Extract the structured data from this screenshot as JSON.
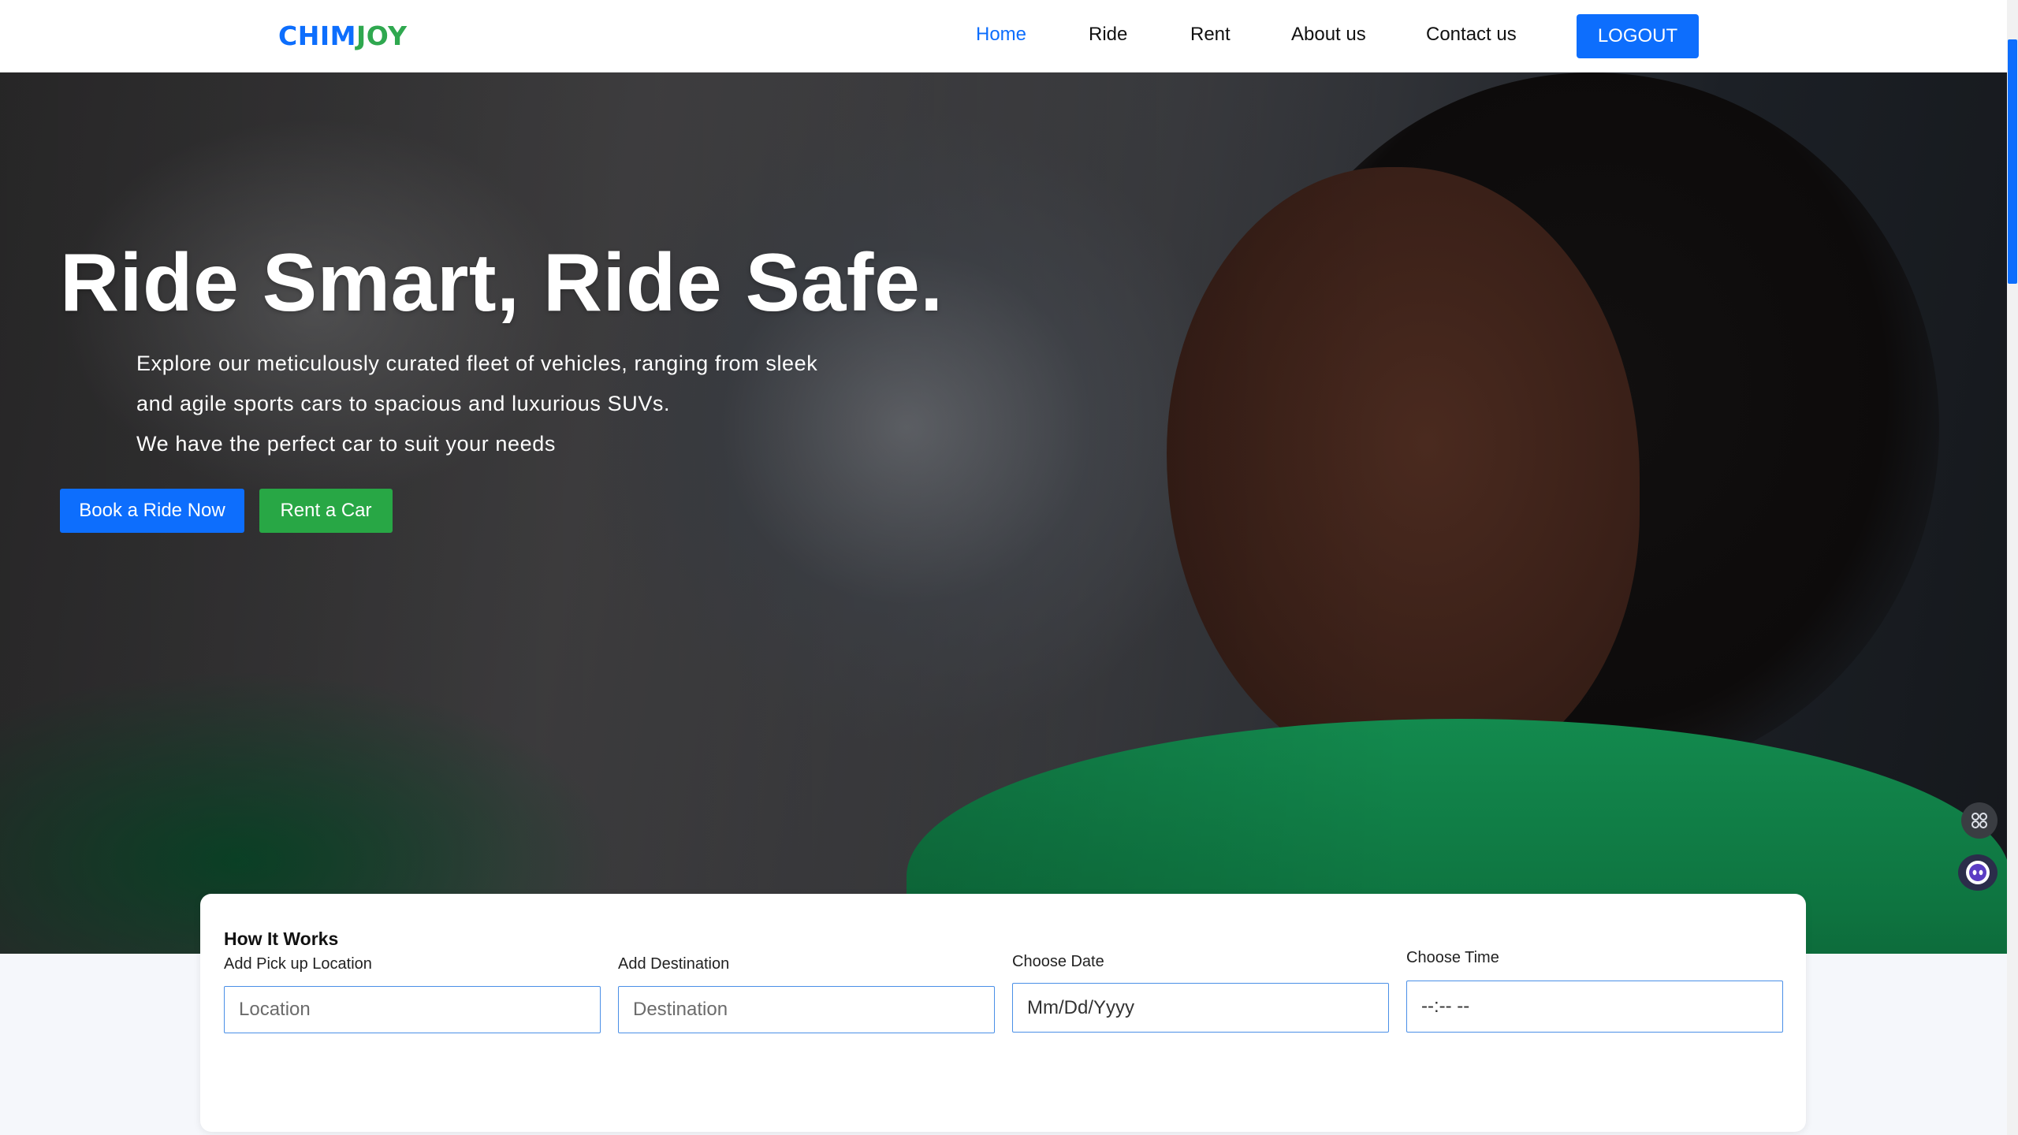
{
  "brand": {
    "part1": "CHIM",
    "part2": "JOY"
  },
  "nav": {
    "items": [
      {
        "label": "Home",
        "active": true
      },
      {
        "label": "Ride",
        "active": false
      },
      {
        "label": "Rent",
        "active": false
      },
      {
        "label": "About us",
        "active": false
      },
      {
        "label": "Contact us",
        "active": false
      }
    ],
    "logout_label": "LOGOUT"
  },
  "hero": {
    "title": "Ride Smart, Ride Safe.",
    "lines": [
      "Explore our meticulously curated fleet of vehicles, ranging from sleek",
      "and agile sports cars to spacious and luxurious SUVs.",
      "We have the perfect car to suit your needs"
    ],
    "book_label": "Book a Ride Now",
    "rent_label": "Rent a Car"
  },
  "booking": {
    "title": "How It Works",
    "fields": [
      {
        "label": "Add Pick up Location",
        "placeholder": "Location"
      },
      {
        "label": "Add Destination",
        "placeholder": "Destination"
      },
      {
        "label": "Choose Date",
        "placeholder": "Mm/Dd/Yyyy"
      },
      {
        "label": "Choose Time",
        "placeholder": "--:-- --"
      }
    ]
  },
  "colors": {
    "primary": "#0d6efd",
    "success": "#28a745",
    "brand_green": "#2fa84f"
  },
  "side_icons": [
    "apps-grid-icon",
    "assistant-bot-icon"
  ]
}
